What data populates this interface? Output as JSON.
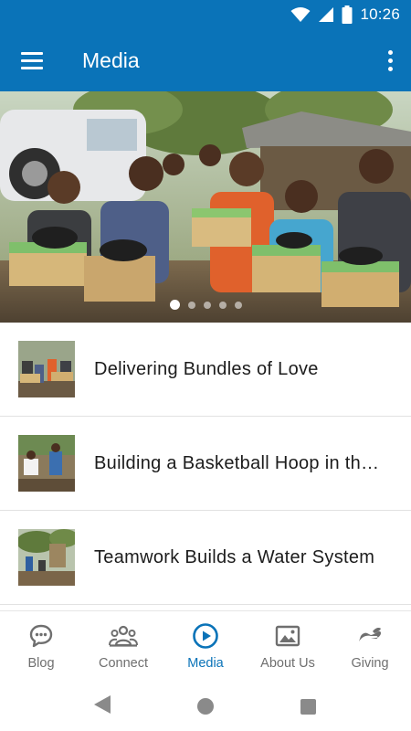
{
  "status": {
    "time": "10:26",
    "icons": [
      "wifi-icon",
      "cell-signal-icon",
      "battery-icon"
    ]
  },
  "appbar": {
    "title": "Media",
    "menu_icon": "hamburger-menu-icon",
    "more_icon": "more-vertical-icon"
  },
  "colors": {
    "primary": "#0a73b8",
    "inactive": "#6f6f6f"
  },
  "carousel": {
    "slide_count": 5,
    "active_slide": 1
  },
  "media_items": [
    {
      "title": "Delivering Bundles of Love"
    },
    {
      "title": "Building a Basketball Hoop in th…"
    },
    {
      "title": "Teamwork Builds a Water System"
    }
  ],
  "bottom_nav": [
    {
      "label": "Blog",
      "icon": "chat-bubble-icon",
      "active": false
    },
    {
      "label": "Connect",
      "icon": "group-icon",
      "active": false
    },
    {
      "label": "Media",
      "icon": "play-circle-icon",
      "active": true
    },
    {
      "label": "About Us",
      "icon": "image-icon",
      "active": false
    },
    {
      "label": "Giving",
      "icon": "giving-hand-icon",
      "active": false
    }
  ]
}
